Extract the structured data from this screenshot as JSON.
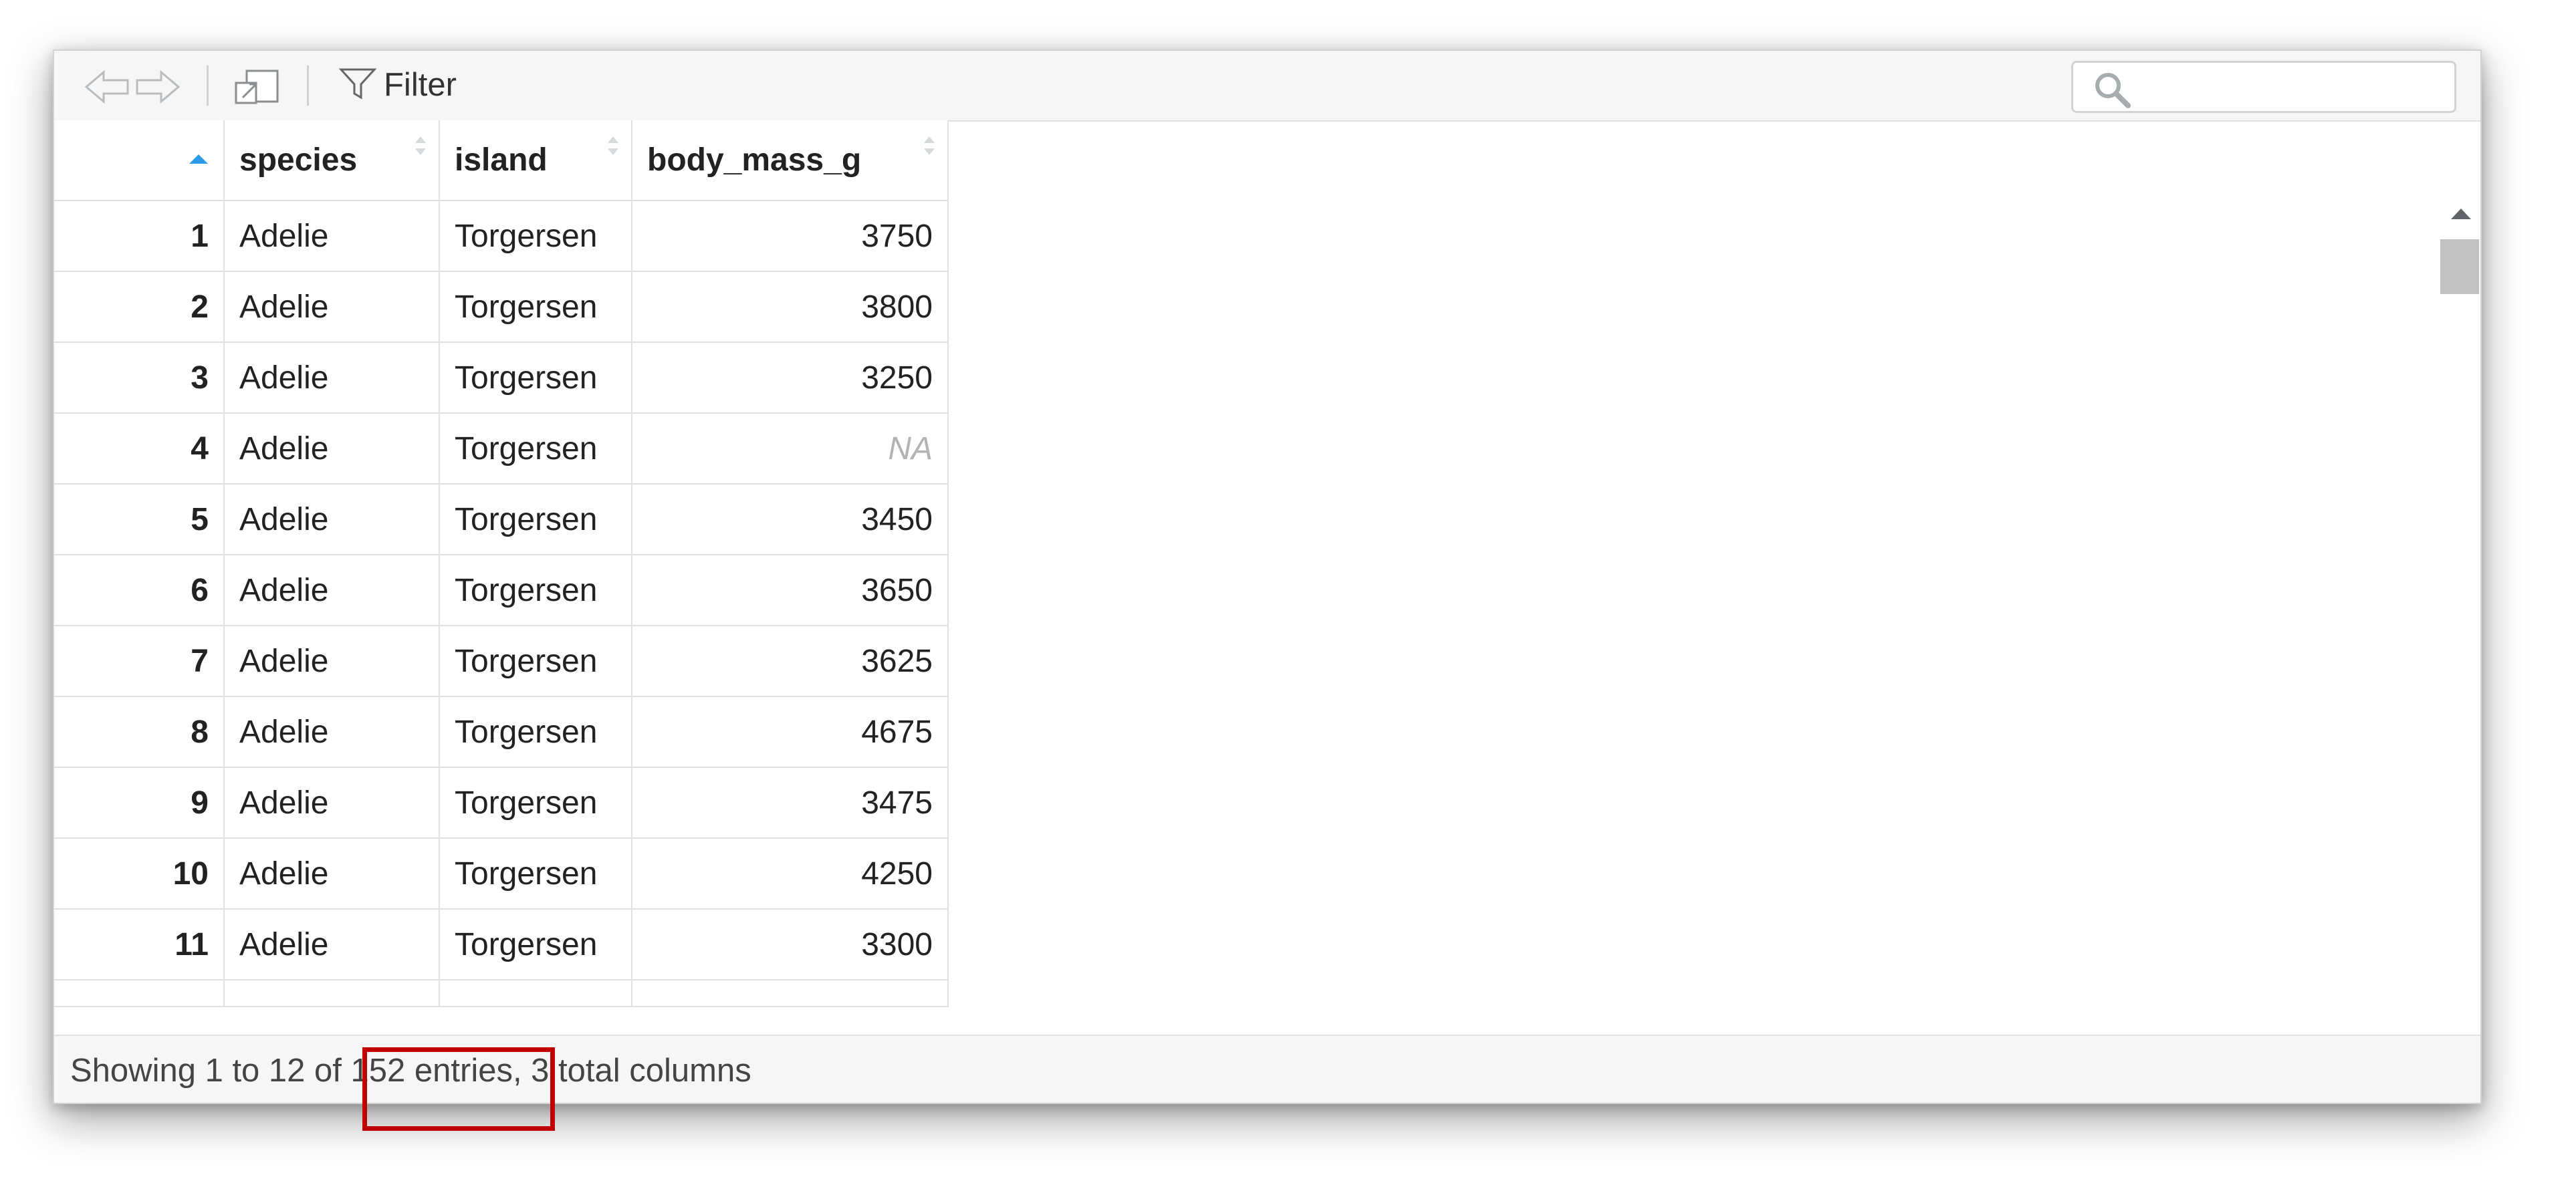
{
  "toolbar": {
    "filter_label": "Filter",
    "search_placeholder": ""
  },
  "table": {
    "columns": [
      "species",
      "island",
      "body_mass_g"
    ],
    "rows": [
      {
        "n": "1",
        "species": "Adelie",
        "island": "Torgersen",
        "body_mass_g": "3750"
      },
      {
        "n": "2",
        "species": "Adelie",
        "island": "Torgersen",
        "body_mass_g": "3800"
      },
      {
        "n": "3",
        "species": "Adelie",
        "island": "Torgersen",
        "body_mass_g": "3250"
      },
      {
        "n": "4",
        "species": "Adelie",
        "island": "Torgersen",
        "body_mass_g": "NA"
      },
      {
        "n": "5",
        "species": "Adelie",
        "island": "Torgersen",
        "body_mass_g": "3450"
      },
      {
        "n": "6",
        "species": "Adelie",
        "island": "Torgersen",
        "body_mass_g": "3650"
      },
      {
        "n": "7",
        "species": "Adelie",
        "island": "Torgersen",
        "body_mass_g": "3625"
      },
      {
        "n": "8",
        "species": "Adelie",
        "island": "Torgersen",
        "body_mass_g": "4675"
      },
      {
        "n": "9",
        "species": "Adelie",
        "island": "Torgersen",
        "body_mass_g": "3475"
      },
      {
        "n": "10",
        "species": "Adelie",
        "island": "Torgersen",
        "body_mass_g": "4250"
      },
      {
        "n": "11",
        "species": "Adelie",
        "island": "Torgersen",
        "body_mass_g": "3300"
      }
    ]
  },
  "footer": {
    "status": "Showing 1 to 12 of 152 entries, 3 total columns"
  },
  "colors": {
    "sort_active": "#2f9be8",
    "highlight": "#c00000",
    "na_text": "#b3b3b3"
  },
  "icons": [
    "back-arrow-icon",
    "forward-arrow-icon",
    "popout-icon",
    "filter-icon",
    "search-icon",
    "sort-arrows-icon",
    "sort-ascending-icon",
    "scroll-up-icon",
    "scroll-down-icon"
  ]
}
